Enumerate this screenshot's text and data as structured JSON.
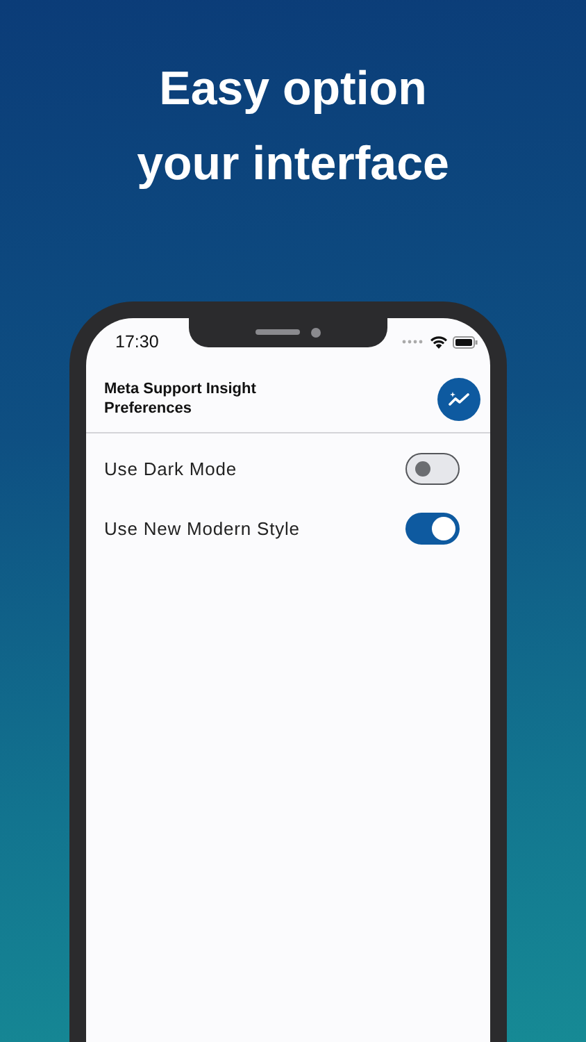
{
  "headline": "Easy option your interface",
  "status_bar": {
    "time": "17:30"
  },
  "header": {
    "title": "Meta Support Insight Preferences"
  },
  "settings": [
    {
      "label": "Use Dark Mode",
      "on": false
    },
    {
      "label": "Use New Modern Style",
      "on": true
    }
  ]
}
